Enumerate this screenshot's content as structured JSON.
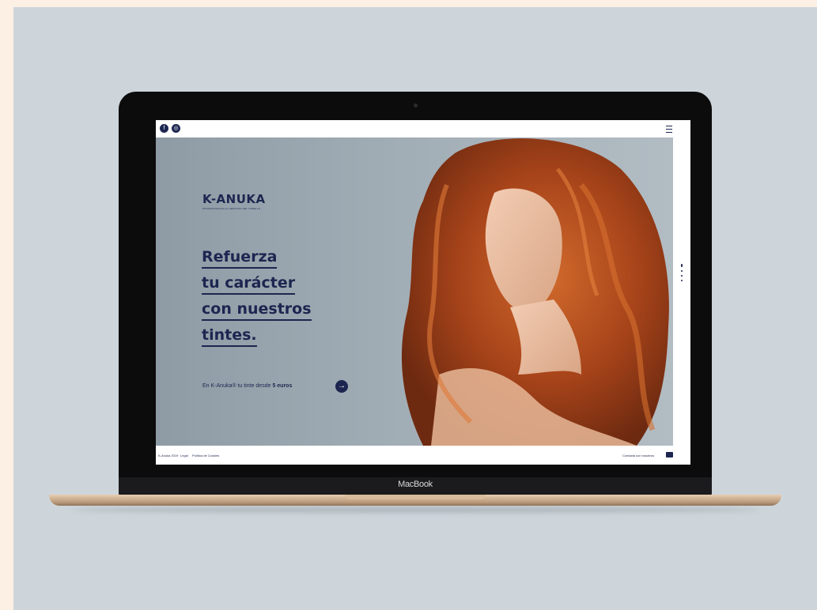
{
  "brand": {
    "name": "K-ANUKA",
    "tagline": "PROFESIONALES AL SERVICIO DEL CABELLO"
  },
  "headline": {
    "lines": [
      "Refuerza",
      "tu carácter",
      "con nuestros",
      "tintes."
    ]
  },
  "cta": {
    "text": "En K-Anuka® tu tinte desde",
    "highlight": "5 euros",
    "button_icon": "→"
  },
  "footer": {
    "copyright": "K-Anuka 2019",
    "links": [
      "Legal",
      "Política de Cookies"
    ],
    "contact": "Contacta con nosotros"
  },
  "device": {
    "label": "MacBook"
  },
  "topbar": {
    "icons": [
      "facebook-icon",
      "instagram-icon",
      "menu-icon"
    ]
  },
  "colors": {
    "brand_navy": "#1c2650",
    "hero_bg": "#9aa6af",
    "hair": "#b5501f",
    "page_bg": "#cdd5da"
  }
}
